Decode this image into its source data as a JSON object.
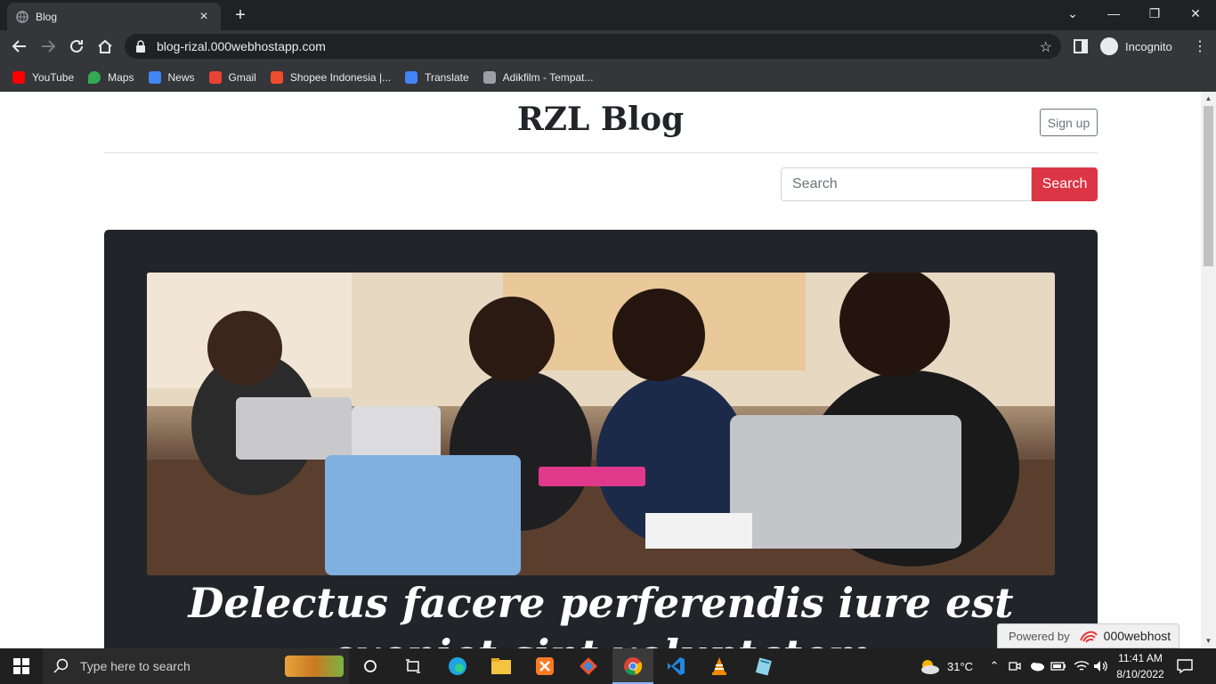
{
  "browser": {
    "tab_title": "Blog",
    "tab_close": "×",
    "new_tab": "+",
    "url": "blog-rizal.000webhostapp.com",
    "profile_label": "Incognito",
    "bookmarks": [
      {
        "label": "YouTube",
        "icon": "youtube-icon",
        "color": "#ff0000"
      },
      {
        "label": "Maps",
        "icon": "maps-icon",
        "color": "#34a853"
      },
      {
        "label": "News",
        "icon": "news-icon",
        "color": "#4285f4"
      },
      {
        "label": "Gmail",
        "icon": "gmail-icon",
        "color": "#ea4335"
      },
      {
        "label": "Shopee Indonesia |...",
        "icon": "shopee-icon",
        "color": "#ee4d2d"
      },
      {
        "label": "Translate",
        "icon": "translate-icon",
        "color": "#4285f4"
      },
      {
        "label": "Adikfilm - Tempat...",
        "icon": "film-icon",
        "color": "#9aa0a6"
      }
    ]
  },
  "page": {
    "brand": "RZL Blog",
    "signup_label": "Sign up",
    "search_placeholder": "Search",
    "search_button": "Search",
    "hero_title": "Delectus facere perferendis iure est eveniet sint voluptatem"
  },
  "badge": {
    "prefix": "Powered by",
    "name": "000webhost"
  },
  "taskbar": {
    "search_placeholder": "Type here to search",
    "weather": "31°C",
    "time": "11:41 AM",
    "date": "8/10/2022"
  }
}
